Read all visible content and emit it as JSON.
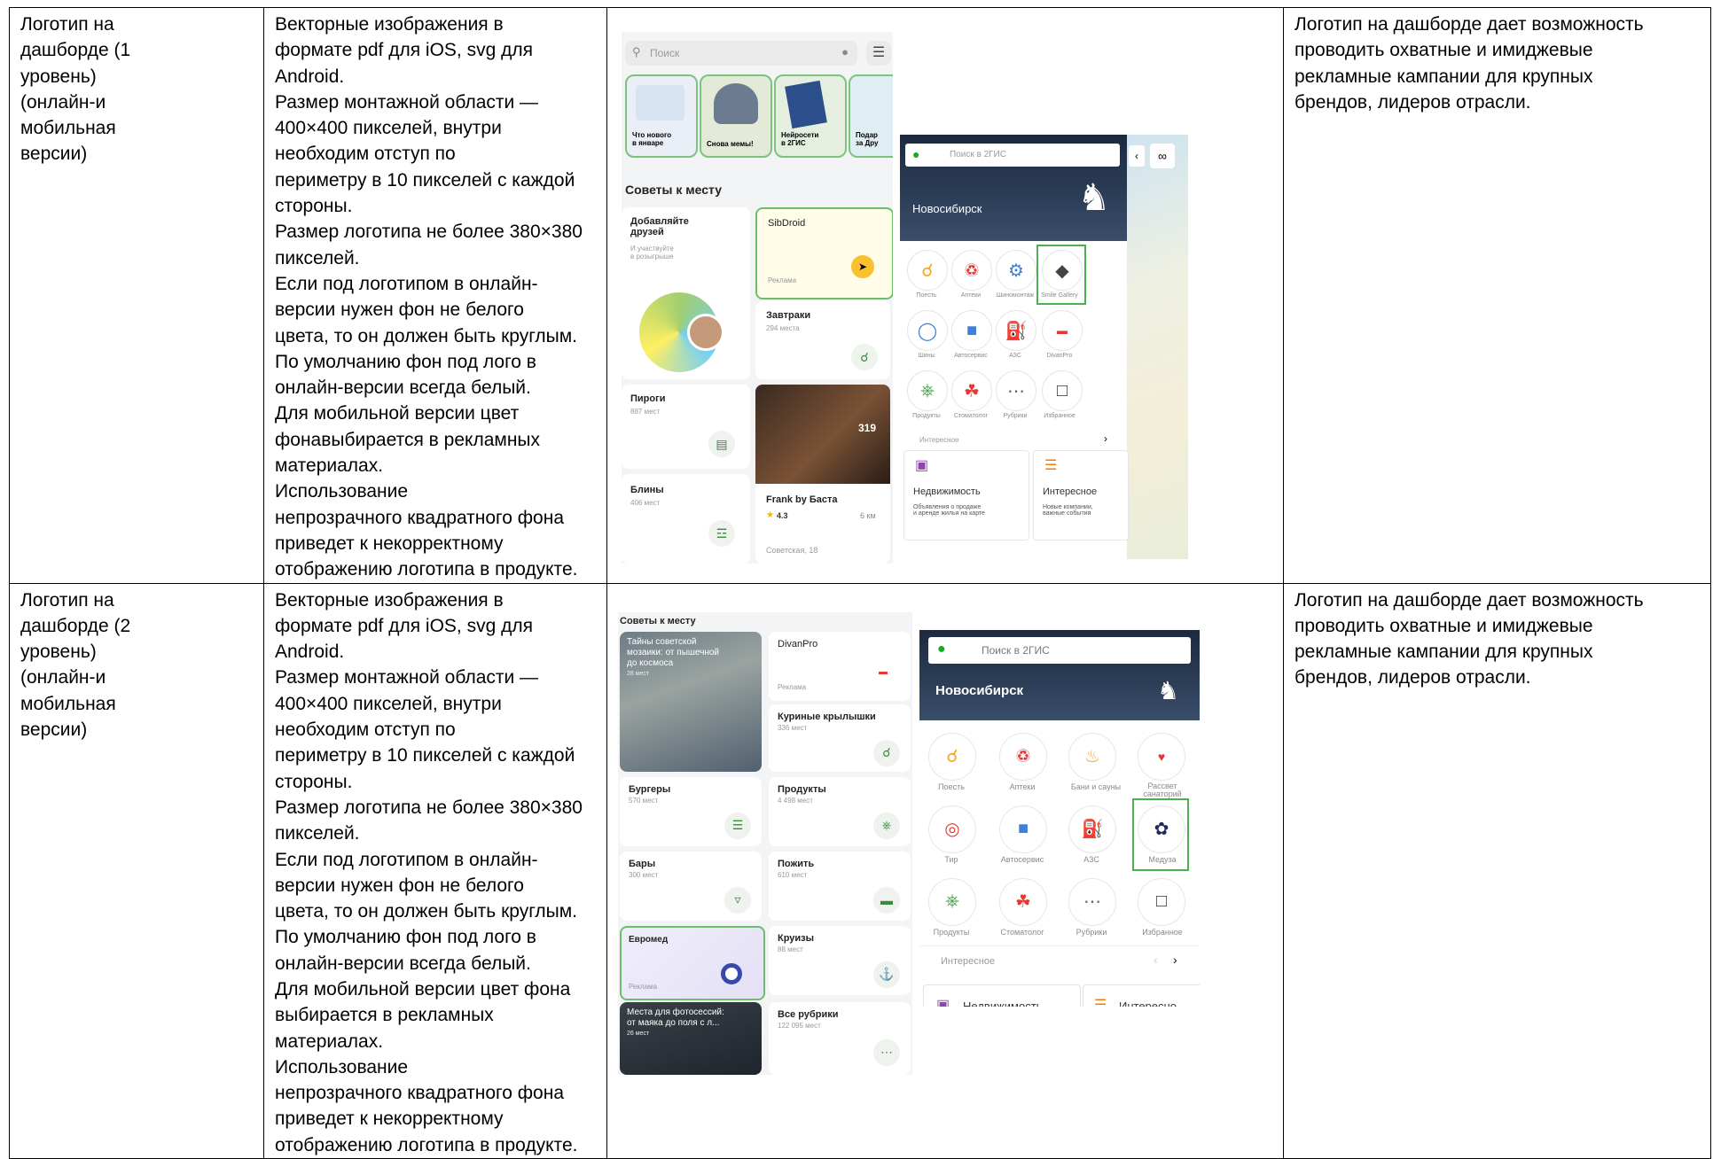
{
  "rows": [
    {
      "title": "Логотип на\nдашборде (1\nуровень)\n(онлайн-и\nмобильная\nверсии)",
      "spec": "Векторные изображения в\nформате pdf для iOS, svg для\nAndroid.\nРазмер монтажной области —\n400×400 пикселей, внутри\nнеобходим отступ по\nпериметру в 10 пикселей с каждой\nстороны.\nРазмер логотипа не более 380×380\nпикселей.\nЕсли под логотипом в онлайн-\nверсии нужен фон не белого\nцвета, то он должен быть круглым.\nПо умолчанию фон под лого в\nонлайн-версии всегда белый.\nДля мобильной версии цвет\nфонавыбирается в рекламных\nматериалах.\nИспользование\nнепрозрачного квадратного фона\nприведет к некорректному\nотображению логотипа в продукте.",
      "note": "Логотип на дашборде дает возможность\nпроводить охватные и имиджевые\nрекламные кампании для крупных\nбрендов, лидеров отрасли."
    },
    {
      "title": "Логотип на\nдашборде (2\nуровень)\n(онлайн-и\nмобильная\nверсии)",
      "spec": "Векторные изображения в\nформате pdf для iOS, svg для\nAndroid.\nРазмер монтажной области —\n400×400 пикселей, внутри\nнеобходим отступ по\nпериметру в 10 пикселей с каждой\nстороны.\nРазмер логотипа не более 380×380\nпикселей.\nЕсли под логотипом в онлайн-\nверсии нужен фон не белого\nцвета, то он должен быть круглым.\nПо умолчанию фон под лого в\nонлайн-версии всегда белый.\nДля мобильной версии цвет фона\nвыбирается в рекламных\nматериалах.\nИспользование\nнепрозрачного квадратного фона\nприведет к некорректному\nотображению логотипа в продукте.",
      "note": "Логотип на дашборде дает возможность\nпроводить охватные и имиджевые\nрекламные кампании для крупных\nбрендов, лидеров отрасли."
    }
  ],
  "m1": {
    "search": "Поиск",
    "stories": [
      "Что нового\nв январе",
      "Снова мемы!",
      "Нейросети\nв 2ГИС",
      "Подар\nза Дру"
    ],
    "section": "Советы к месту",
    "c1_title": "Добавляйте\nдрузей",
    "c1_sub": "И участвуйте\nв розыгрыше",
    "c2_title": "SibDroid",
    "c2_ad": "Реклама",
    "c3_title": "Завтраки",
    "c3_sub": "294 места",
    "c4_title": "Пироги",
    "c4_sub": "887 мест",
    "c5_badge": "319",
    "c5_title": "Frank by Баста",
    "c5_rating": "4.3",
    "c5_dist": "6 км",
    "c5_addr": "Советская, 18",
    "c6_title": "Блины",
    "c6_sub": "406 мест"
  },
  "w1": {
    "search": "Поиск в 2ГИС",
    "city": "Новосибирск",
    "labels": [
      "Поесть",
      "Аптеки",
      "Шиномонтаж",
      "Smile Gallery",
      "Шины",
      "Автосервис",
      "АЗС",
      "DivanPro",
      "Продукты",
      "Стоматолог",
      "Рубрики",
      "Избранное"
    ],
    "interesting": "Интересное",
    "card1_title": "Недвижимость",
    "card1_sub": "Объявления о продаже\nи аренде жилья на карте",
    "card2_title": "Интересное",
    "card2_sub": "Новые компании,\nважные события"
  },
  "m2": {
    "section": "Советы к месту",
    "cards": [
      {
        "title": "Тайны советской\nмозаики: от пышечной\nдо космоса",
        "sub": "28 мест"
      },
      {
        "title": "DivanPro",
        "sub": "Реклама"
      },
      {
        "title": "Куриные крылышки",
        "sub": "336 мест"
      },
      {
        "title": "Бургеры",
        "sub": "570 мест"
      },
      {
        "title": "Продукты",
        "sub": "4 498 мест"
      },
      {
        "title": "Бары",
        "sub": "300 мест"
      },
      {
        "title": "Пожить",
        "sub": "610 мест"
      },
      {
        "title": "Евромед",
        "sub": "Реклама"
      },
      {
        "title": "Круизы",
        "sub": "88 мест"
      },
      {
        "title": "Места для фотосессий:\nот маяка до поля с л...",
        "sub": "26 мест"
      },
      {
        "title": "Все рубрики",
        "sub": "122 095 мест"
      }
    ]
  },
  "w2": {
    "search": "Поиск в 2ГИС",
    "city": "Новосибирск",
    "labels": [
      "Поесть",
      "Аптеки",
      "Бани и сауны",
      "Рассвет\nсанаторий",
      "Тир",
      "Автосервис",
      "АЗС",
      "Медуза",
      "Продукты",
      "Стоматолог",
      "Рубрики",
      "Избранное"
    ],
    "interesting": "Интересное",
    "btn1": "Недвижимость",
    "btn2": "Интересно"
  },
  "colors": {
    "highlight": "#4caf50",
    "accent": "#e53935",
    "brand": "#2e7d32"
  }
}
